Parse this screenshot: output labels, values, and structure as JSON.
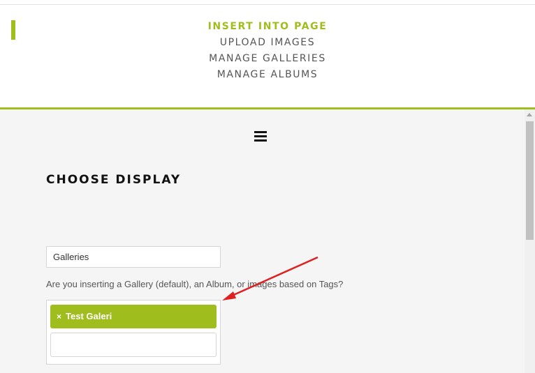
{
  "colors": {
    "accent": "#a0bd1e",
    "annotation_arrow": "#e02020"
  },
  "menu": {
    "items": [
      {
        "label": "INSERT INTO PAGE",
        "active": true
      },
      {
        "label": "UPLOAD IMAGES",
        "active": false
      },
      {
        "label": "MANAGE GALLERIES",
        "active": false
      },
      {
        "label": "MANAGE ALBUMS",
        "active": false
      }
    ]
  },
  "icons": {
    "menu_toggle": "hamburger-icon",
    "remove_tag": "close-icon"
  },
  "main": {
    "title": "CHOOSE DISPLAY",
    "display_type": {
      "selected": "Galleries"
    },
    "help_text": "Are you inserting a Gallery (default), an Album, or images based on Tags?",
    "selected_tags": [
      {
        "remove_glyph": "×",
        "label": "Test Galeri"
      }
    ]
  }
}
